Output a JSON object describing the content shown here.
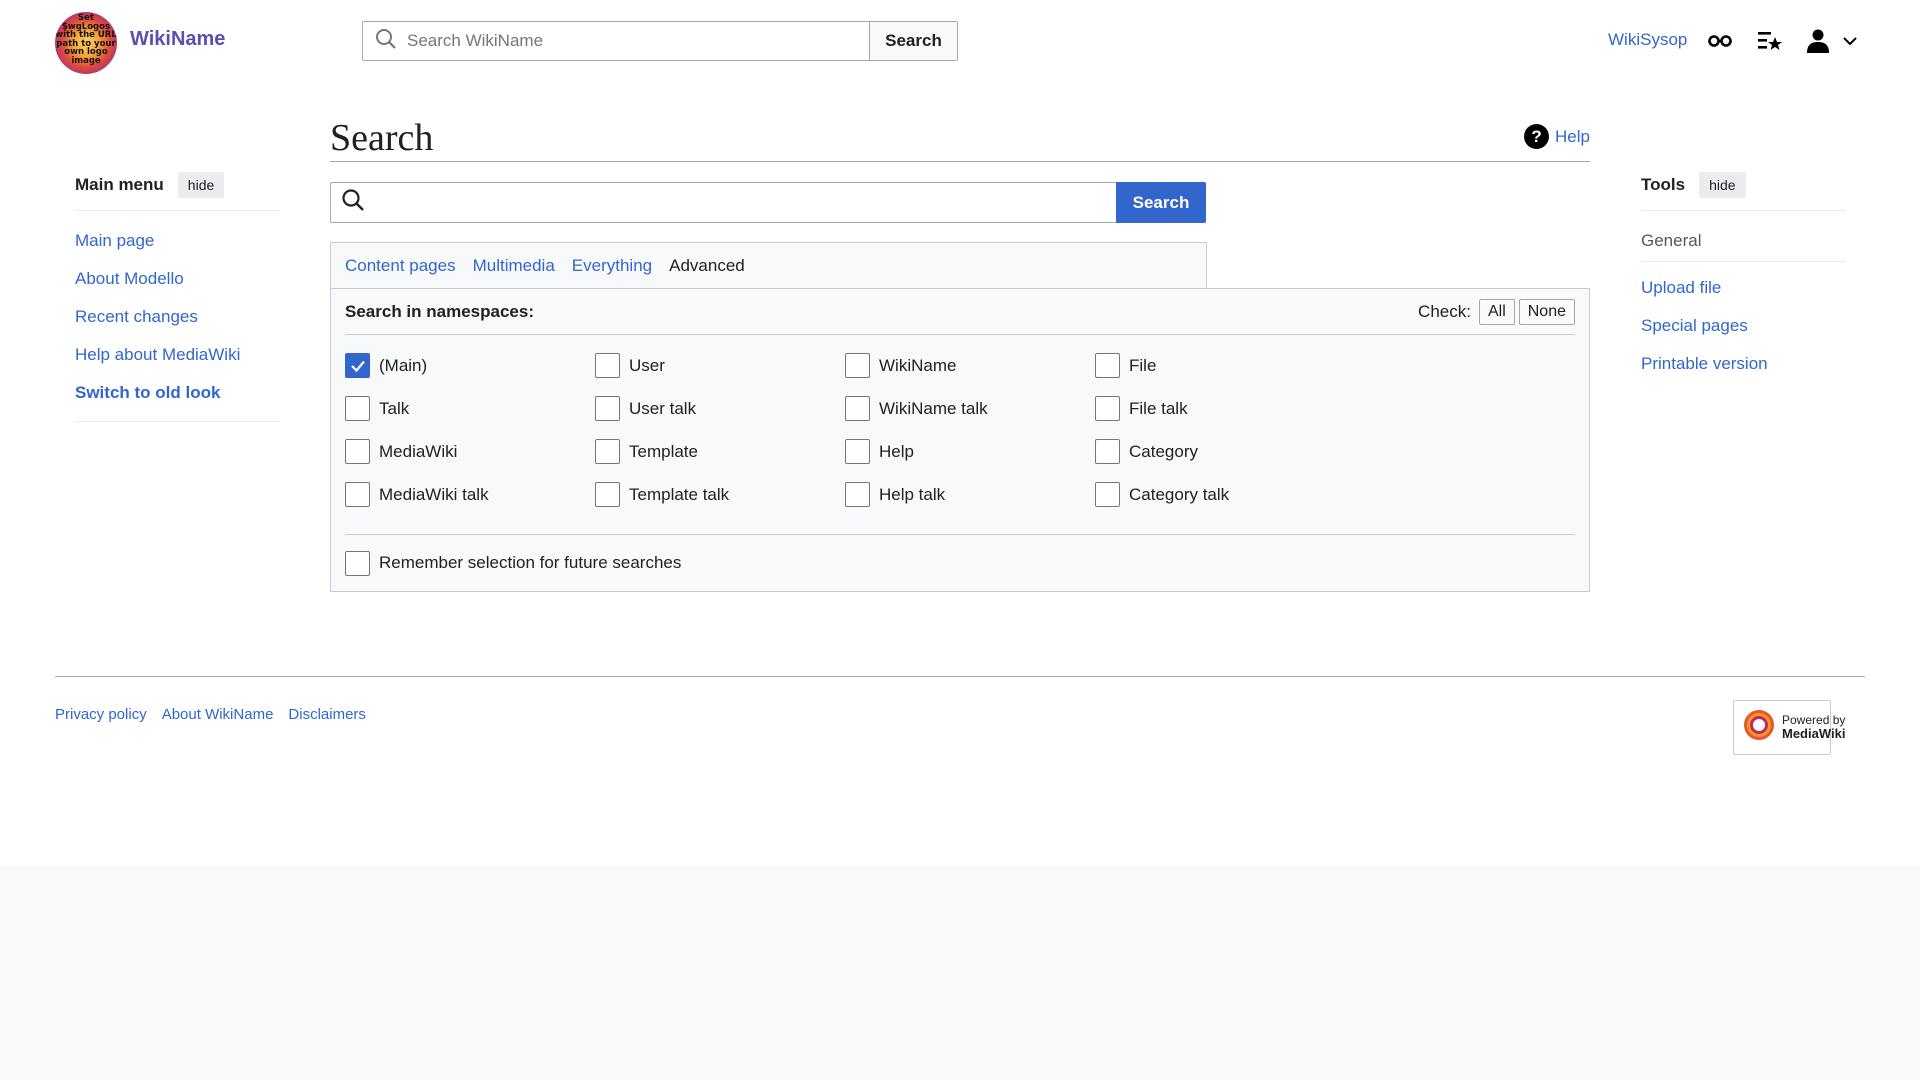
{
  "header": {
    "logo_text": "Set $wgLogos with the URL path to your own logo image",
    "wordmark": "WikiName",
    "search_placeholder": "Search WikiName",
    "search_button": "Search",
    "user_name": "WikiSysop",
    "icons": [
      "glasses-icon",
      "watchlist-icon",
      "user-icon",
      "chevron-down-icon"
    ]
  },
  "main_menu": {
    "title": "Main menu",
    "hide_label": "hide",
    "items": [
      {
        "label": "Main page"
      },
      {
        "label": "About Modello"
      },
      {
        "label": "Recent changes"
      },
      {
        "label": "Help about MediaWiki"
      },
      {
        "label": "Switch to old look"
      }
    ]
  },
  "tools": {
    "title": "Tools",
    "hide_label": "hide",
    "section": "General",
    "items": [
      {
        "label": "Upload file"
      },
      {
        "label": "Special pages"
      },
      {
        "label": "Printable version"
      }
    ]
  },
  "page": {
    "title": "Search",
    "help_label": "Help",
    "search_value": "",
    "search_button": "Search",
    "tabs": [
      {
        "label": "Content pages",
        "active": false
      },
      {
        "label": "Multimedia",
        "active": false
      },
      {
        "label": "Everything",
        "active": false
      },
      {
        "label": "Advanced",
        "active": true
      }
    ],
    "namespaces_label": "Search in namespaces:",
    "check_label": "Check:",
    "check_all": "All",
    "check_none": "None",
    "namespaces": [
      {
        "label": "(Main)",
        "checked": true
      },
      {
        "label": "User",
        "checked": false
      },
      {
        "label": "WikiName",
        "checked": false
      },
      {
        "label": "File",
        "checked": false
      },
      {
        "label": "Talk",
        "checked": false
      },
      {
        "label": "User talk",
        "checked": false
      },
      {
        "label": "WikiName talk",
        "checked": false
      },
      {
        "label": "File talk",
        "checked": false
      },
      {
        "label": "MediaWiki",
        "checked": false
      },
      {
        "label": "Template",
        "checked": false
      },
      {
        "label": "Help",
        "checked": false
      },
      {
        "label": "Category",
        "checked": false
      },
      {
        "label": "MediaWiki talk",
        "checked": false
      },
      {
        "label": "Template talk",
        "checked": false
      },
      {
        "label": "Help talk",
        "checked": false
      },
      {
        "label": "Category talk",
        "checked": false
      }
    ],
    "remember_label": "Remember selection for future searches",
    "remember_checked": false
  },
  "footer": {
    "links": [
      {
        "label": "Privacy policy"
      },
      {
        "label": "About WikiName"
      },
      {
        "label": "Disclaimers"
      }
    ],
    "powered_line1": "Powered by",
    "powered_line2": "MediaWiki"
  },
  "colors": {
    "link": "#3366cc",
    "accent": "#3366cc",
    "text": "#202122",
    "border": "#a2a9b1"
  }
}
